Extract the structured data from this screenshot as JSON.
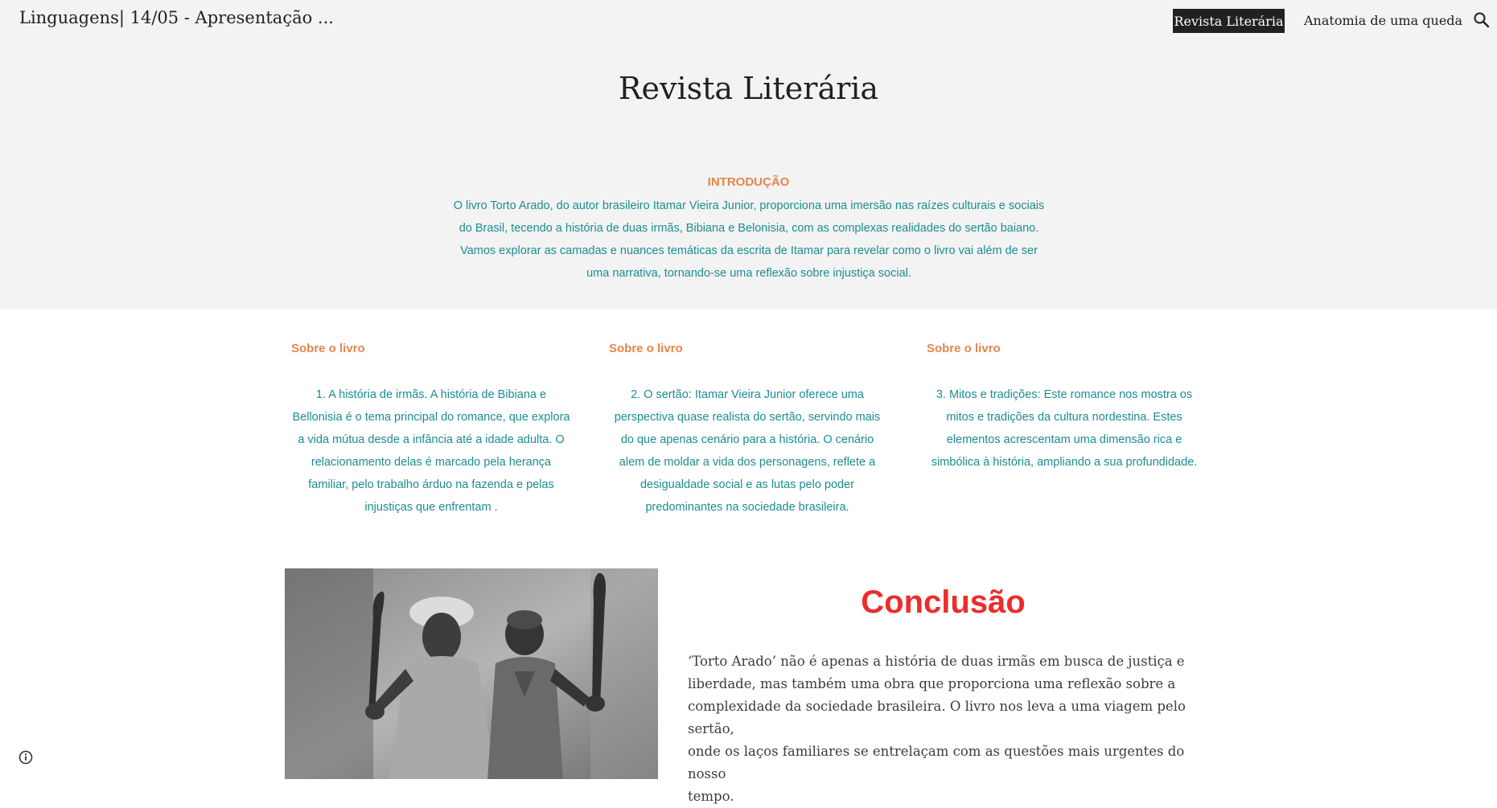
{
  "header": {
    "site_title": "Linguagens| 14/05 - Apresentação ...",
    "nav": [
      {
        "label": "Revista Literária",
        "active": true
      },
      {
        "label": "Anatomia de uma queda",
        "active": false
      }
    ],
    "search_icon": "search-icon"
  },
  "hero": {
    "title": "Revista Literária",
    "intro_title": "INTRODUÇÃO",
    "intro_lines": [
      "O livro Torto Arado, do autor brasileiro Itamar Vieira Junior, proporciona uma imersão nas raízes culturais e sociais",
      "do Brasil, tecendo a história de duas irmãs, Bibiana e Belonisia, com as complexas realidades do sertão baiano.",
      "Vamos explorar as camadas e nuances temáticas da escrita de Itamar para revelar como o livro vai além de ser",
      "uma narrativa, tornando-se uma reflexão sobre injustiça social."
    ]
  },
  "columns": [
    {
      "title": "Sobre o livro",
      "lines": [
        "1. A história de irmãs. A história de Bibiana e",
        "Bellonisia é o tema principal do romance, que explora",
        "a vida mútua desde a infância até a idade adulta. O",
        "relacionamento delas é marcado pela herança",
        "familiar, pelo trabalho árduo na fazenda e pelas",
        "injustiças que enfrentam ."
      ]
    },
    {
      "title": "Sobre o livro",
      "lines": [
        "2. O sertão: Itamar Vieira Junior oferece uma",
        "perspectiva quase realista do sertão, servindo mais",
        "do que apenas cenário para a história. O cenário",
        "alem de moldar a vida dos personagens, reflete a",
        "desigualdade social e as lutas pelo poder",
        "predominantes na sociedade brasileira."
      ]
    },
    {
      "title": "Sobre o livro",
      "lines": [
        "3. Mitos e tradições: Este romance nos mostra os",
        "mitos e tradições da cultura nordestina. Estes",
        "elementos acrescentam uma dimensão rica e",
        "simbólica à história, ampliando a sua profundidade."
      ]
    }
  ],
  "conclusion": {
    "title": "Conclusão",
    "lines": [
      "‘Torto Arado’ não é apenas a história de duas irmãs em busca de justiça e",
      "liberdade, mas também uma obra que proporciona uma reflexão sobre a",
      "complexidade da sociedade brasileira. O livro nos leva a uma viagem pelo sertão,",
      "onde os laços familiares se entrelaçam com as questões mais urgentes do nosso",
      "tempo."
    ]
  },
  "colors": {
    "accent_orange": "#e6854a",
    "text_teal": "#1b8d93",
    "conclusion_red": "#ee2c2c",
    "hero_bg": "#f3f3f3"
  }
}
